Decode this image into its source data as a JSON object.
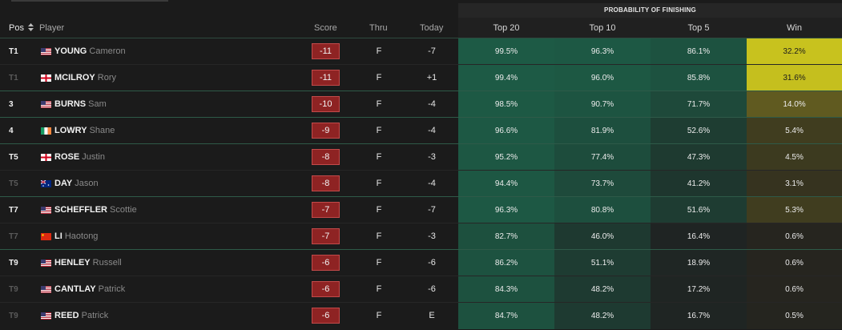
{
  "banner": "PROBABILITY OF FINISHING",
  "headers": {
    "pos": "Pos",
    "player": "Player",
    "score": "Score",
    "thru": "Thru",
    "today": "Today",
    "top20": "Top 20",
    "top10": "Top 10",
    "top5": "Top 5",
    "win": "Win"
  },
  "colors": {
    "score_bg": "#8e2323",
    "win_high": "#c8c21e",
    "win_mid": "#6b6420",
    "prob_green": "#1d5a45"
  },
  "rows": [
    {
      "pos": "T1",
      "flag": "us",
      "last": "YOUNG",
      "first": "Cameron",
      "score": "-11",
      "thru": "F",
      "today": "-7",
      "top20": "99.5%",
      "top10": "96.3%",
      "top5": "86.1%",
      "win": "32.2%"
    },
    {
      "pos": "T1",
      "flag": "nir",
      "last": "MCILROY",
      "first": "Rory",
      "score": "-11",
      "thru": "F",
      "today": "+1",
      "top20": "99.4%",
      "top10": "96.0%",
      "top5": "85.8%",
      "win": "31.6%"
    },
    {
      "pos": "3",
      "flag": "us",
      "last": "BURNS",
      "first": "Sam",
      "score": "-10",
      "thru": "F",
      "today": "-4",
      "top20": "98.5%",
      "top10": "90.7%",
      "top5": "71.7%",
      "win": "14.0%"
    },
    {
      "pos": "4",
      "flag": "irl",
      "last": "LOWRY",
      "first": "Shane",
      "score": "-9",
      "thru": "F",
      "today": "-4",
      "top20": "96.6%",
      "top10": "81.9%",
      "top5": "52.6%",
      "win": "5.4%"
    },
    {
      "pos": "T5",
      "flag": "eng",
      "last": "ROSE",
      "first": "Justin",
      "score": "-8",
      "thru": "F",
      "today": "-3",
      "top20": "95.2%",
      "top10": "77.4%",
      "top5": "47.3%",
      "win": "4.5%"
    },
    {
      "pos": "T5",
      "flag": "aus",
      "last": "DAY",
      "first": "Jason",
      "score": "-8",
      "thru": "F",
      "today": "-4",
      "top20": "94.4%",
      "top10": "73.7%",
      "top5": "41.2%",
      "win": "3.1%"
    },
    {
      "pos": "T7",
      "flag": "us",
      "last": "SCHEFFLER",
      "first": "Scottie",
      "score": "-7",
      "thru": "F",
      "today": "-7",
      "top20": "96.3%",
      "top10": "80.8%",
      "top5": "51.6%",
      "win": "5.3%"
    },
    {
      "pos": "T7",
      "flag": "chn",
      "last": "LI",
      "first": "Haotong",
      "score": "-7",
      "thru": "F",
      "today": "-3",
      "top20": "82.7%",
      "top10": "46.0%",
      "top5": "16.4%",
      "win": "0.6%"
    },
    {
      "pos": "T9",
      "flag": "us",
      "last": "HENLEY",
      "first": "Russell",
      "score": "-6",
      "thru": "F",
      "today": "-6",
      "top20": "86.2%",
      "top10": "51.1%",
      "top5": "18.9%",
      "win": "0.6%"
    },
    {
      "pos": "T9",
      "flag": "us",
      "last": "CANTLAY",
      "first": "Patrick",
      "score": "-6",
      "thru": "F",
      "today": "-6",
      "top20": "84.3%",
      "top10": "48.2%",
      "top5": "17.2%",
      "win": "0.6%"
    },
    {
      "pos": "T9",
      "flag": "us",
      "last": "REED",
      "first": "Patrick",
      "score": "-6",
      "thru": "F",
      "today": "E",
      "top20": "84.7%",
      "top10": "48.2%",
      "top5": "16.7%",
      "win": "0.5%"
    }
  ]
}
